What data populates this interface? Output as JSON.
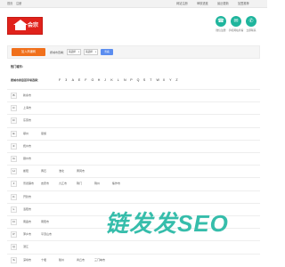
{
  "topbar": {
    "left_links": [
      "首页",
      "注册"
    ],
    "right_links": [
      "网站注册",
      "审核进度",
      "最近更新",
      "加盟推荐"
    ]
  },
  "logo": {
    "text": "会宗"
  },
  "header_icons": [
    {
      "icon": "phone-icon",
      "label": "微信注册"
    },
    {
      "icon": "chat-icon",
      "label": "手机网站查看"
    },
    {
      "icon": "mail-icon",
      "label": "立即联系"
    }
  ],
  "filter_bar": {
    "join_button": "加入商铺网",
    "location_label": "按城市查看：",
    "select_province": "请选择",
    "select_city": "请选择",
    "search_button": "查看"
  },
  "hot_cities_title": "热门城市：",
  "letter_nav": {
    "label": "按城市拼音首字母选择：",
    "letters": [
      "F",
      "3",
      "A",
      "E",
      "F",
      "G",
      "H",
      "J",
      "K",
      "L",
      "N",
      "P",
      "Q",
      "S",
      "T",
      "W",
      "X",
      "Y",
      "Z"
    ]
  },
  "city_rows": [
    {
      "letter": "B",
      "cities": [
        "新余市"
      ]
    },
    {
      "letter": "C",
      "cities": [
        "上海市"
      ]
    },
    {
      "letter": "D",
      "cities": [
        "东营市"
      ]
    },
    {
      "letter": "E",
      "cities": [
        "鄂州",
        "恩施"
      ]
    },
    {
      "letter": "F",
      "cities": [
        "抚州市"
      ]
    },
    {
      "letter": "G",
      "cities": [
        "赣州市"
      ]
    },
    {
      "letter": "H",
      "cities": [
        "衡阳",
        "黄石",
        "淮北",
        "黄冈市"
      ]
    },
    {
      "letter": "J",
      "cities": [
        "景德镇市",
        "吉安市",
        "九江市",
        "荆门",
        "荆州",
        "焦作市"
      ]
    },
    {
      "letter": "K",
      "cities": [
        "开封市"
      ]
    },
    {
      "letter": "L",
      "cities": [
        "洛阳市"
      ]
    },
    {
      "letter": "N",
      "cities": [
        "南昌市",
        "南阳市"
      ]
    },
    {
      "letter": "P",
      "cities": [
        "萍乡市",
        "平顶山市"
      ]
    },
    {
      "letter": "Q",
      "cities": [
        "潜江"
      ]
    },
    {
      "letter": "S",
      "cities": [
        "深圳市",
        "十堰",
        "随州",
        "商丘市",
        "三门峡市"
      ]
    }
  ],
  "watermark": {
    "text": "链发发SEO"
  },
  "colors": {
    "logo_red": "#e0221b",
    "accent_teal": "#1fb59d",
    "join_orange": "#f0701c",
    "search_blue": "#5b8def",
    "watermark_teal": "#26b8a4"
  }
}
